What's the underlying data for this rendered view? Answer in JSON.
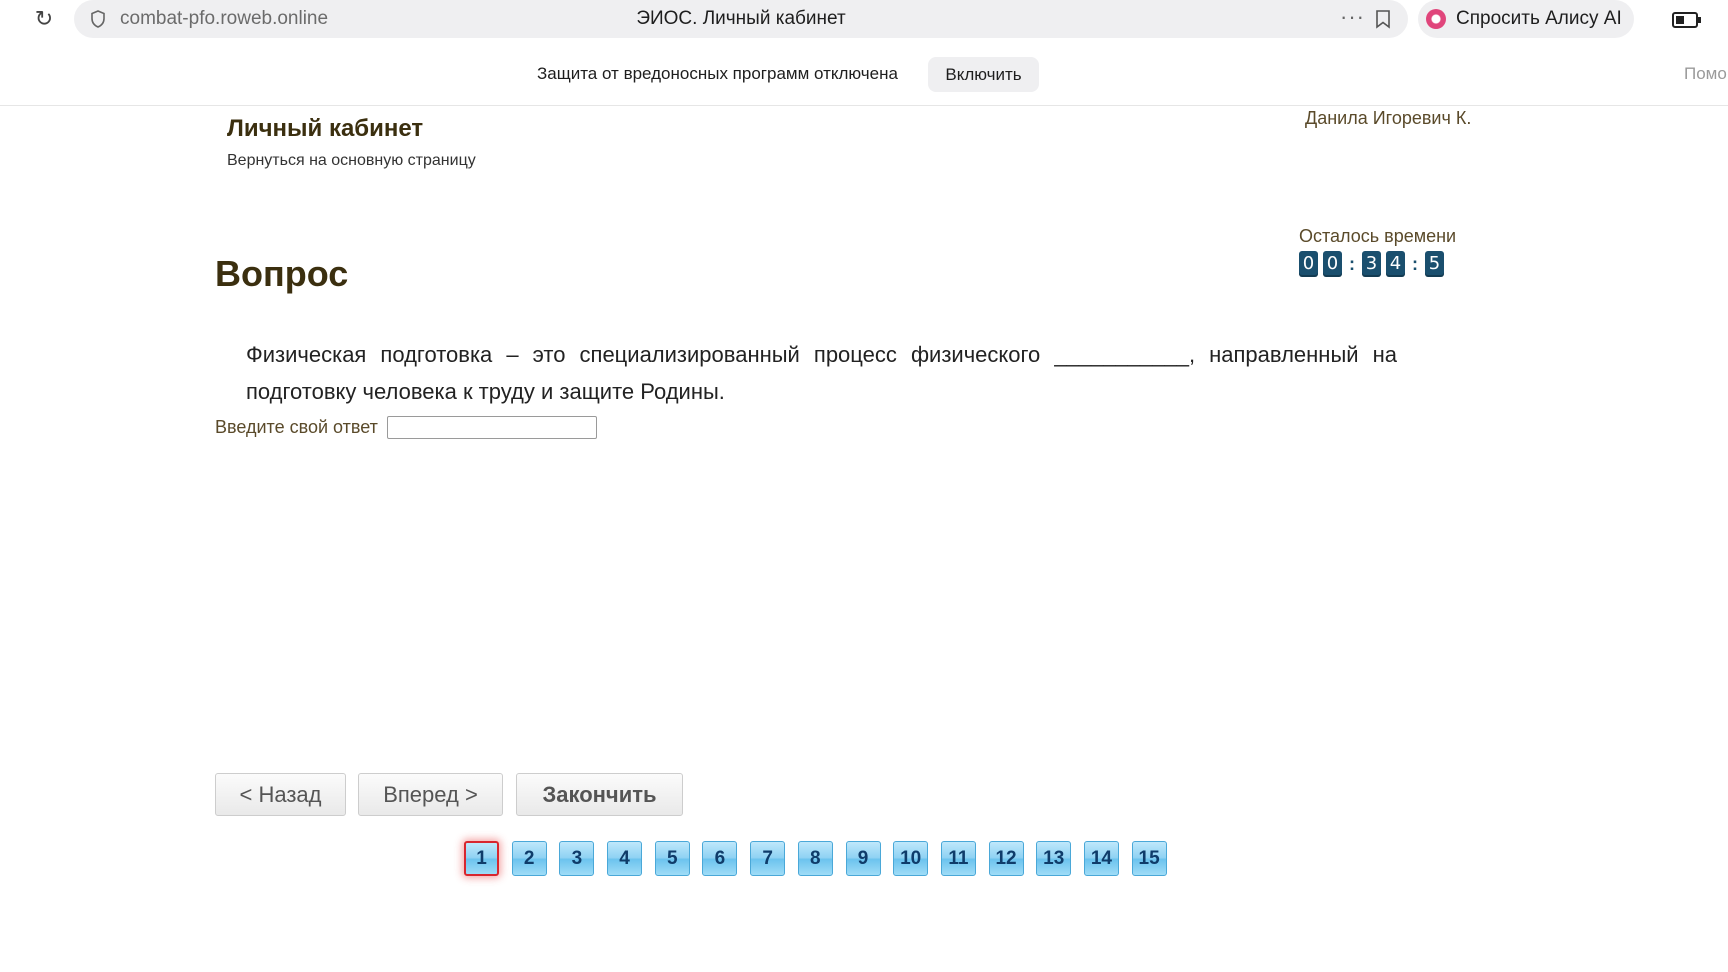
{
  "browser": {
    "url": "combat-pfo.roweb.online",
    "tab_title": "ЭИОС. Личный кабинет",
    "more_label": "···",
    "alice_label": "Спросить Алису AI",
    "notice": {
      "text": "Защита от вредоносных программ отключена",
      "button": "Включить",
      "help_label": "Помо"
    }
  },
  "header": {
    "title": "Личный кабинет",
    "back_link": "Вернуться на основную страницу",
    "user_name": "Данила Игоревич К."
  },
  "timer": {
    "label": "Осталось времени",
    "digits": [
      "0",
      "0",
      "3",
      "4",
      "5"
    ]
  },
  "question": {
    "heading": "Вопрос",
    "text": "Физическая подготовка – это специализированный процесс физического ___________, направленный на подготовку человека к труду и защите Родины.",
    "answer_label": "Введите свой ответ",
    "answer_value": ""
  },
  "navigation": {
    "back": "< Назад",
    "next": "Вперед >",
    "finish": "Закончить"
  },
  "pager": {
    "pages": [
      "1",
      "2",
      "3",
      "4",
      "5",
      "6",
      "7",
      "8",
      "9",
      "10",
      "11",
      "12",
      "13",
      "14",
      "15"
    ],
    "current": "1"
  },
  "colors": {
    "heading": "#3b2f0f",
    "timer_digit_bg": "#1a4f6e",
    "page_button": "#8fd2f3",
    "current_page_border": "#d8262e"
  }
}
